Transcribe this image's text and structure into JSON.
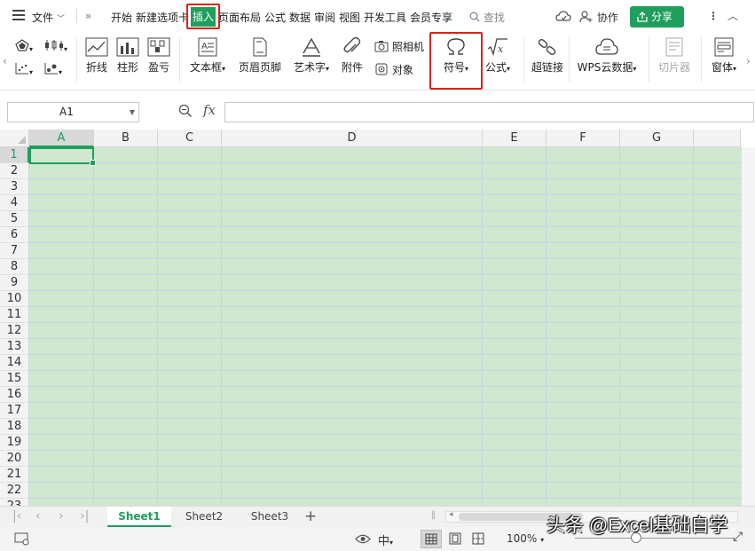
{
  "menubar": {
    "file": "文件",
    "tabs": [
      "开始",
      "新建选项卡",
      "插入",
      "页面布局",
      "公式",
      "数据",
      "审阅",
      "视图",
      "开发工具",
      "会员专享"
    ],
    "active_tab": "插入",
    "search": "查找",
    "collab": "协作",
    "share": "分享"
  },
  "ribbon": {
    "line": "折线",
    "column": "柱形",
    "winloss": "盈亏",
    "textbox": "文本框",
    "header_footer": "页眉页脚",
    "wordart": "艺术字",
    "attachment": "附件",
    "camera": "照相机",
    "object": "对象",
    "symbol": "符号",
    "formula": "公式",
    "hyperlink": "超链接",
    "wps_cloud_data": "WPS云数据",
    "slicer": "切片器",
    "window": "窗体"
  },
  "formula_bar": {
    "cell_ref": "A1",
    "fx": "fx",
    "value": ""
  },
  "grid": {
    "columns": [
      "A",
      "B",
      "C",
      "D",
      "E",
      "F",
      "G"
    ],
    "rows": [
      "1",
      "2",
      "3",
      "4",
      "5",
      "6",
      "7",
      "8",
      "9",
      "10",
      "11",
      "12",
      "13",
      "14",
      "15",
      "16",
      "17",
      "18",
      "19",
      "20",
      "21",
      "22",
      "23"
    ],
    "selected_cell": "A1"
  },
  "sheets": {
    "tabs": [
      "Sheet1",
      "Sheet2",
      "Sheet3"
    ],
    "active": "Sheet1"
  },
  "statusbar": {
    "zoom": "100%"
  },
  "watermark": "头条 @Excel基础自学",
  "colors": {
    "accent": "#1e9f5c",
    "cell_fill": "#cfe8cf",
    "highlight": "#e0201c"
  }
}
